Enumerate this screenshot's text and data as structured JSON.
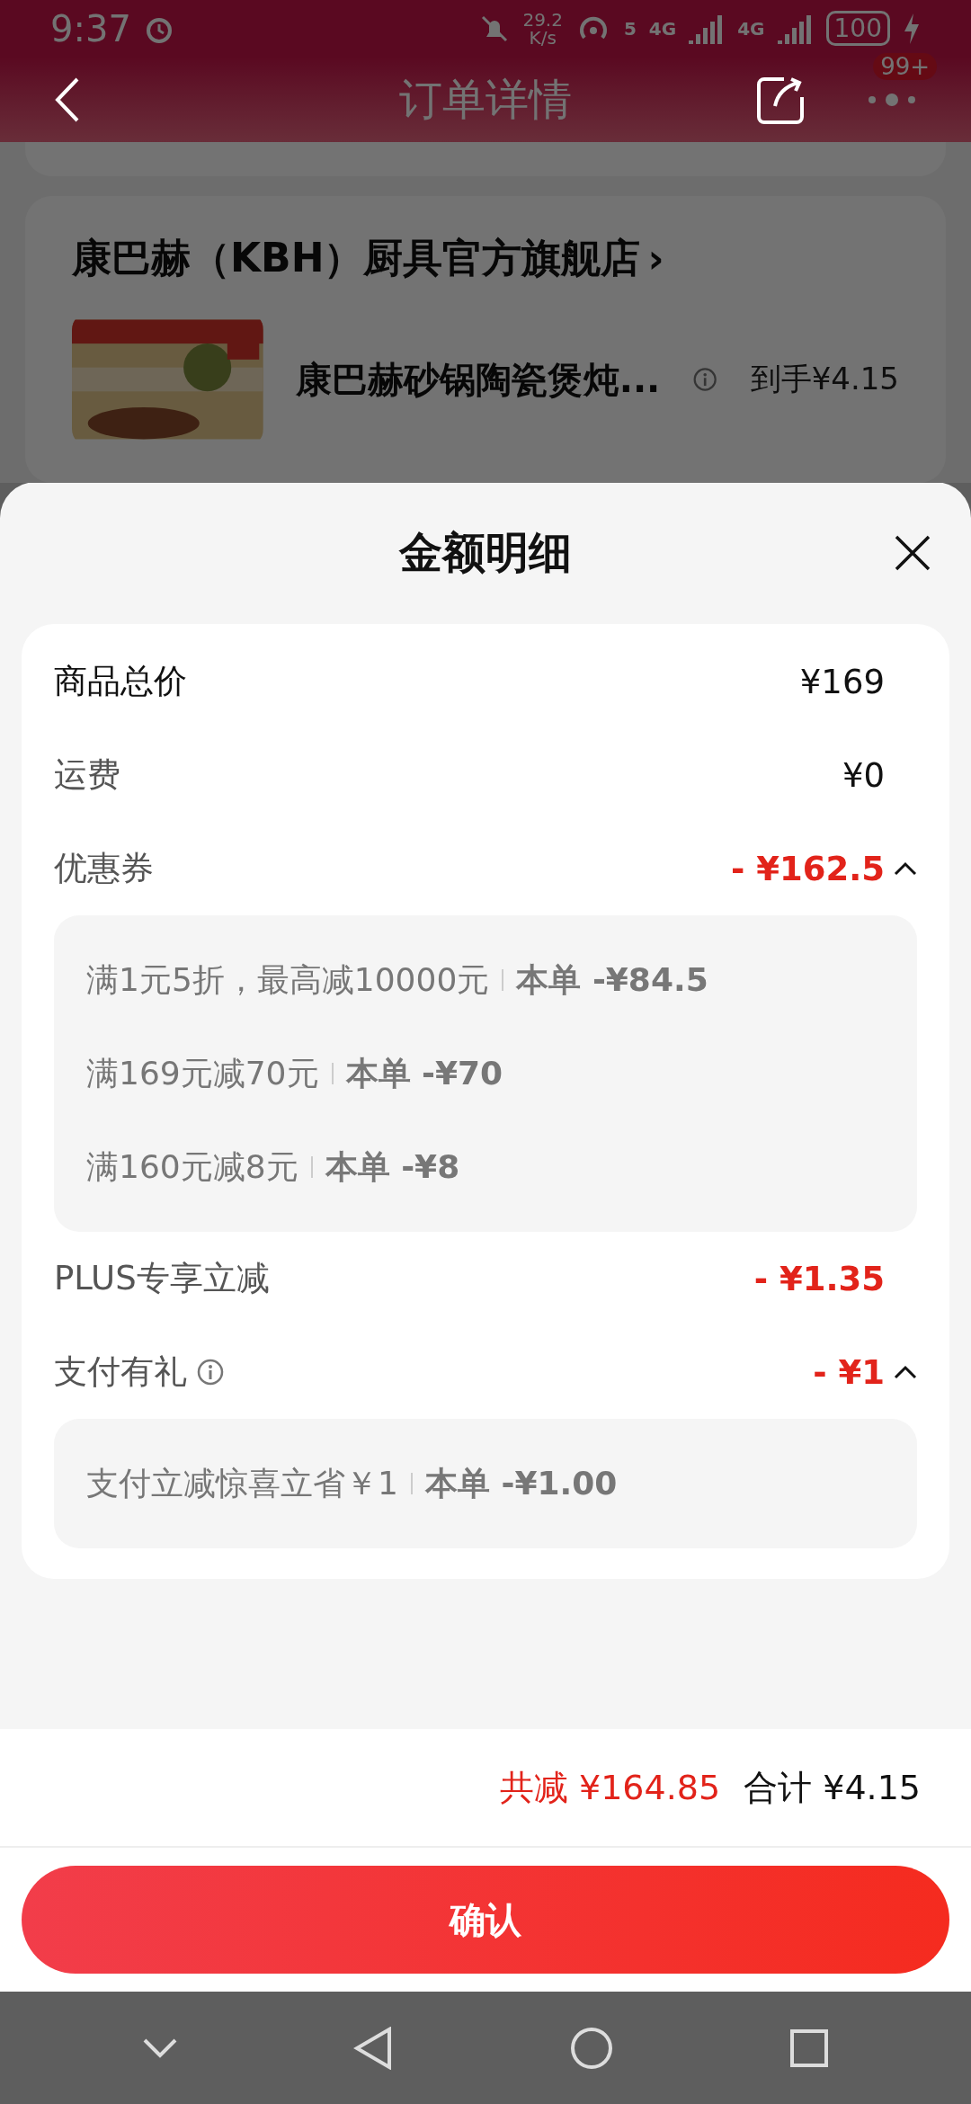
{
  "status_bar": {
    "time": "9:37",
    "net_speed_value": "29.2",
    "net_speed_unit": "K/s",
    "hotspot_label": "5",
    "signals": [
      "4G",
      "4G"
    ],
    "battery": "100"
  },
  "header": {
    "title": "订单详情",
    "badge": "99+"
  },
  "order_behind": {
    "store": "康巴赫（KBH）厨具官方旗舰店",
    "store_arrow": "›",
    "product_title": "康巴赫砂锅陶瓷煲炖...",
    "price_label": "到手",
    "price": "¥4.15"
  },
  "sheet": {
    "title": "金额明细",
    "rows": [
      {
        "kind": "plain",
        "label": "商品总价",
        "amount": "¥169",
        "strong": true
      },
      {
        "kind": "plain",
        "label": "运费",
        "amount": "¥0",
        "strong": false
      },
      {
        "kind": "discount",
        "label": "优惠券",
        "amount": "- ¥162.5",
        "info": false,
        "expanded": true,
        "details": [
          {
            "condition": "满1元5折，最高减10000元",
            "amount": "本单 -¥84.5"
          },
          {
            "condition": "满169元减70元",
            "amount": "本单 -¥70"
          },
          {
            "condition": "满160元减8元",
            "amount": "本单 -¥8"
          }
        ]
      },
      {
        "kind": "discount",
        "label": "PLUS专享立减",
        "amount": "- ¥1.35",
        "info": false
      },
      {
        "kind": "discount",
        "label": "支付有礼",
        "amount": "- ¥1",
        "info": true,
        "expanded": true,
        "details": [
          {
            "condition": "支付立减惊喜立省￥1",
            "amount": "本单 -¥1.00"
          }
        ]
      }
    ]
  },
  "summary": {
    "reduction_label": "共减",
    "reduction": "¥164.85",
    "total_label": "合计",
    "total": "¥4.15"
  },
  "confirm_button": "确认"
}
